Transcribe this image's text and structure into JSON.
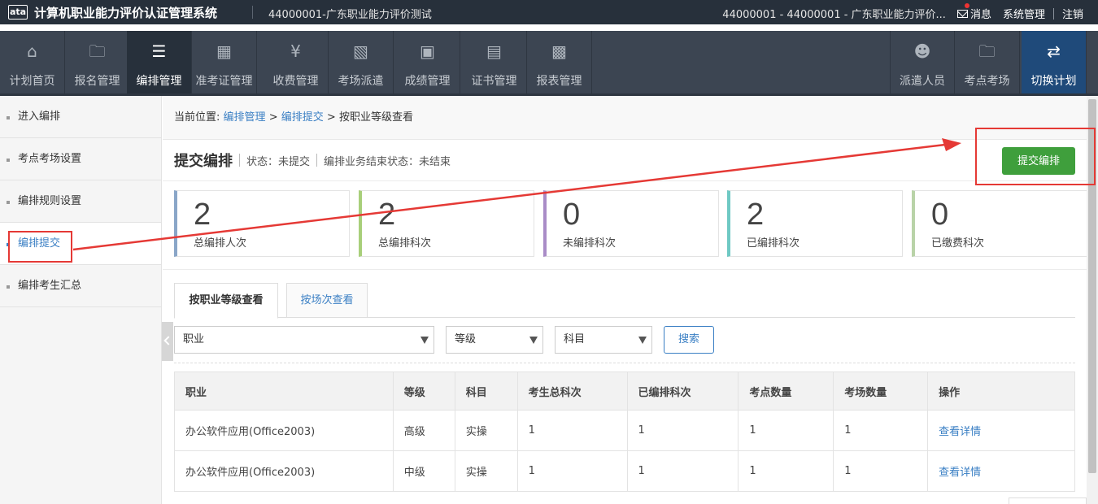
{
  "header": {
    "logo_text": "ata",
    "app_title": "计算机职业能力评价认证管理系统",
    "plan_code": "44000001-广东职业能力评价测试",
    "org": "44000001 - 44000001 - 广东职业能力评价...",
    "messages_label": "消息",
    "system_label": "系统管理",
    "logout_label": "注销"
  },
  "nav": {
    "items": [
      {
        "label": "计划首页",
        "icon": "home-icon"
      },
      {
        "label": "报名管理",
        "icon": "folder-icon"
      },
      {
        "label": "编排管理",
        "icon": "arrange-icon"
      },
      {
        "label": "准考证管理",
        "icon": "id-card-icon"
      },
      {
        "label": "收费管理",
        "icon": "yen-receipt-icon"
      },
      {
        "label": "考场派遣",
        "icon": "building-icon"
      },
      {
        "label": "成绩管理",
        "icon": "score-icon"
      },
      {
        "label": "证书管理",
        "icon": "certificate-icon"
      },
      {
        "label": "报表管理",
        "icon": "chart-icon"
      }
    ],
    "right_items": [
      {
        "label": "派遣人员",
        "icon": "user-icon"
      },
      {
        "label": "考点考场",
        "icon": "folder-icon"
      },
      {
        "label": "切换计划",
        "icon": "switch-arrows-icon"
      }
    ]
  },
  "sidebar": {
    "items": [
      {
        "label": "进入编排"
      },
      {
        "label": "考点考场设置"
      },
      {
        "label": "编排规则设置"
      },
      {
        "label": "编排提交"
      },
      {
        "label": "编排考生汇总"
      }
    ]
  },
  "breadcrumb": {
    "prefix": "当前位置:",
    "level1": "编排管理",
    "sep": ">",
    "level2": "编排提交",
    "current": "按职业等级查看"
  },
  "page": {
    "title": "提交编排",
    "status": "状态：未提交",
    "end_status": "编排业务结束状态：未结束",
    "submit_label": "提交编排"
  },
  "stats": [
    {
      "value": "2",
      "label": "总编排人次",
      "color": "#8aa6c8"
    },
    {
      "value": "2",
      "label": "总编排科次",
      "color": "#a8cf7a"
    },
    {
      "value": "0",
      "label": "未编排科次",
      "color": "#a98cc7"
    },
    {
      "value": "2",
      "label": "已编排科次",
      "color": "#6fc9c4"
    },
    {
      "value": "0",
      "label": "已缴费科次",
      "color": "#b9d3a8"
    }
  ],
  "tabs": [
    {
      "label": "按职业等级查看"
    },
    {
      "label": "按场次查看"
    }
  ],
  "filters": {
    "occupation": "职业",
    "level": "等级",
    "subject": "科目",
    "search_label": "搜索"
  },
  "table": {
    "columns": [
      "职业",
      "等级",
      "科目",
      "考生总科次",
      "已编排科次",
      "考点数量",
      "考场数量",
      "操作"
    ],
    "rows": [
      [
        "办公软件应用(Office2003)",
        "高级",
        "实操",
        "1",
        "1",
        "1",
        "1",
        "查看详情"
      ],
      [
        "办公软件应用(Office2003)",
        "中级",
        "实操",
        "1",
        "1",
        "1",
        "1",
        "查看详情"
      ]
    ]
  },
  "colors": {
    "topbar": "#27303b",
    "navbar": "#3c4552",
    "accent": "#3a7fc4",
    "submit": "#3f9f3c",
    "annotation": "#e53935"
  }
}
